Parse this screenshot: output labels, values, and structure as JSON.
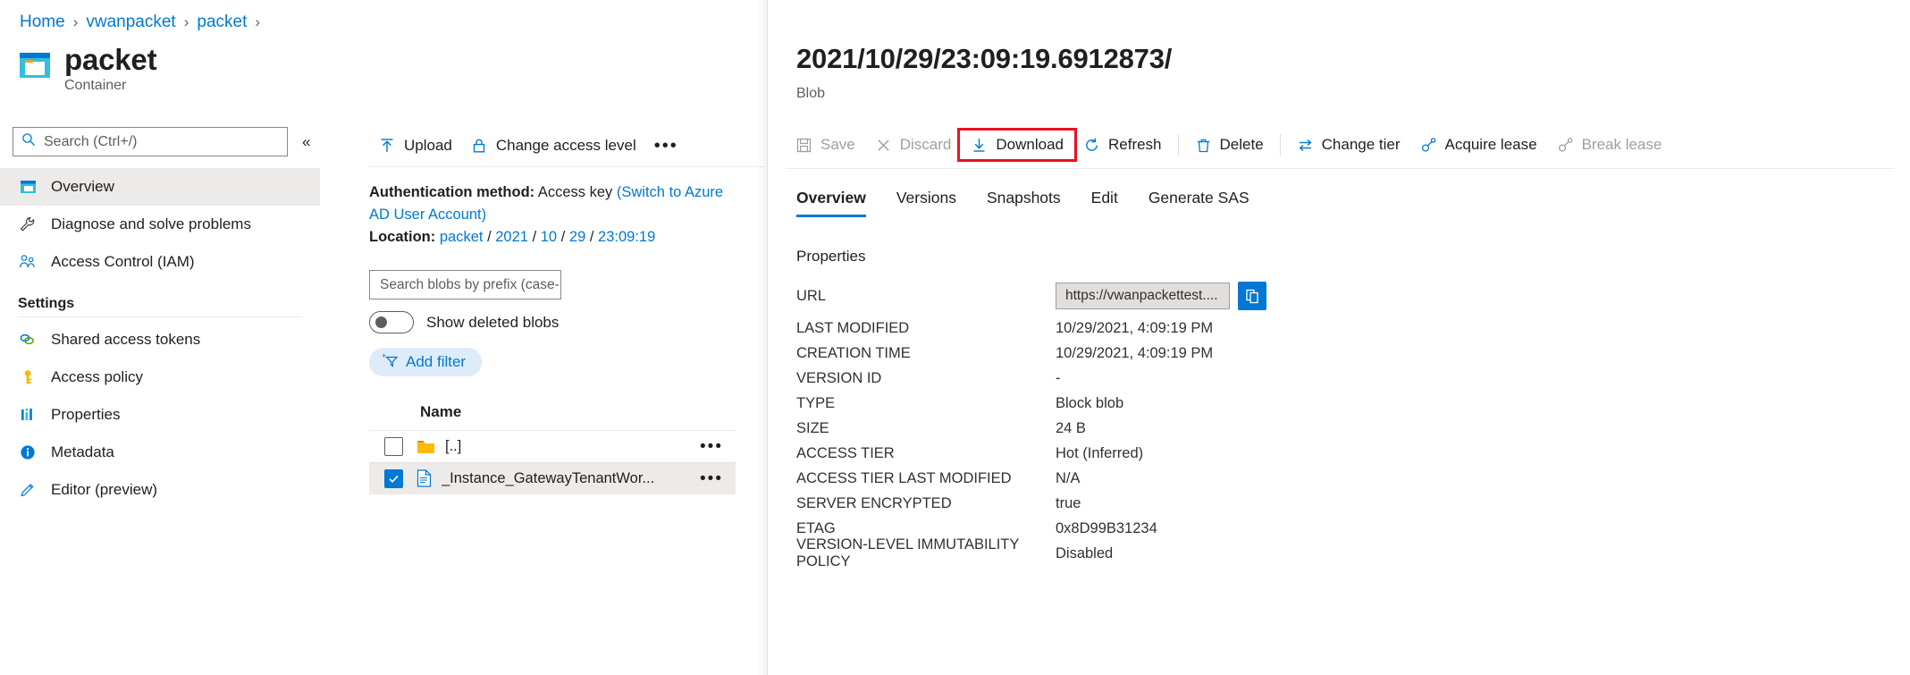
{
  "breadcrumb": {
    "items": [
      {
        "label": "Home",
        "link": true
      },
      {
        "label": "vwanpacket",
        "link": true
      },
      {
        "label": "packet",
        "link": true
      }
    ],
    "separator": "›"
  },
  "resource": {
    "title": "packet",
    "subtitle": "Container",
    "icon": "container-icon"
  },
  "leftnav": {
    "search": {
      "placeholder": "Search (Ctrl+/)",
      "value": "",
      "icon": "search-icon"
    },
    "collapse_icon": "«",
    "items": [
      {
        "label": "Overview",
        "icon": "overview-icon",
        "selected": true
      },
      {
        "label": "Diagnose and solve problems",
        "icon": "wrench-icon",
        "selected": false
      },
      {
        "label": "Access Control (IAM)",
        "icon": "people-icon",
        "selected": false
      }
    ],
    "group_title": "Settings",
    "settings_items": [
      {
        "label": "Shared access tokens",
        "icon": "link-rings-icon"
      },
      {
        "label": "Access policy",
        "icon": "key-icon"
      },
      {
        "label": "Properties",
        "icon": "bars-icon"
      },
      {
        "label": "Metadata",
        "icon": "info-icon"
      },
      {
        "label": "Editor (preview)",
        "icon": "pencil-icon"
      }
    ]
  },
  "midpanel": {
    "toolbar": [
      {
        "label": "Upload",
        "icon": "upload-icon"
      },
      {
        "label": "Change access level",
        "icon": "lock-icon"
      }
    ],
    "overflow_label": "•••",
    "auth": {
      "method_label": "Authentication method:",
      "method_value": "Access key",
      "switch_link": "(Switch to Azure AD User Account)",
      "location_label": "Location:",
      "location_parts": [
        "packet",
        "2021",
        "10",
        "29",
        "23:09:19"
      ],
      "location_sep": "/"
    },
    "blob_search": {
      "placeholder": "Search blobs by prefix (case-...",
      "value": ""
    },
    "show_deleted": {
      "label": "Show deleted blobs",
      "on": false
    },
    "add_filter": {
      "label": "Add filter",
      "icon": "add-filter-icon"
    },
    "filelist": {
      "header": "Name",
      "rows": [
        {
          "name": "[..]",
          "icon": "folder-icon",
          "checked": false,
          "selected": false,
          "menu": "•••"
        },
        {
          "name": "_Instance_GatewayTenantWor...",
          "icon": "file-icon",
          "checked": true,
          "selected": true,
          "menu": "•••"
        }
      ]
    }
  },
  "rightpanel": {
    "title": "2021/10/29/23:09:19.6912873/",
    "subtitle": "Blob",
    "commands": [
      {
        "label": "Save",
        "icon": "save-icon",
        "disabled": true,
        "highlighted": false,
        "sep_after": false
      },
      {
        "label": "Discard",
        "icon": "discard-icon",
        "disabled": true,
        "highlighted": false,
        "sep_after": false
      },
      {
        "label": "Download",
        "icon": "download-icon",
        "disabled": false,
        "highlighted": true,
        "sep_after": false
      },
      {
        "label": "Refresh",
        "icon": "refresh-icon",
        "disabled": false,
        "highlighted": false,
        "sep_after": true
      },
      {
        "label": "Delete",
        "icon": "trash-icon",
        "disabled": false,
        "highlighted": false,
        "sep_after": true
      },
      {
        "label": "Change tier",
        "icon": "change-tier-icon",
        "disabled": false,
        "highlighted": false,
        "sep_after": false
      },
      {
        "label": "Acquire lease",
        "icon": "lease-icon",
        "disabled": false,
        "highlighted": false,
        "sep_after": false
      },
      {
        "label": "Break lease",
        "icon": "lease-icon",
        "disabled": true,
        "highlighted": false,
        "sep_after": false
      }
    ],
    "tabs": [
      {
        "label": "Overview",
        "active": true
      },
      {
        "label": "Versions",
        "active": false
      },
      {
        "label": "Snapshots",
        "active": false
      },
      {
        "label": "Edit",
        "active": false
      },
      {
        "label": "Generate SAS",
        "active": false
      }
    ],
    "properties_heading": "Properties",
    "url": {
      "key": "URL",
      "value": "https://vwanpackettest....",
      "copy_icon": "copy-icon"
    },
    "rows": [
      {
        "key": "LAST MODIFIED",
        "value": "10/29/2021, 4:09:19 PM"
      },
      {
        "key": "CREATION TIME",
        "value": "10/29/2021, 4:09:19 PM"
      },
      {
        "key": "VERSION ID",
        "value": "-"
      },
      {
        "key": "TYPE",
        "value": "Block blob"
      },
      {
        "key": "SIZE",
        "value": "24 B"
      },
      {
        "key": "ACCESS TIER",
        "value": "Hot (Inferred)"
      },
      {
        "key": "ACCESS TIER LAST MODIFIED",
        "value": "N/A"
      },
      {
        "key": "SERVER ENCRYPTED",
        "value": "true"
      },
      {
        "key": "ETAG",
        "value": "0x8D99B31234"
      },
      {
        "key": "VERSION-LEVEL IMMUTABILITY POLICY",
        "value": "Disabled"
      }
    ]
  },
  "colors": {
    "accent": "#0078d4",
    "highlight_box": "#e81123",
    "selected_bg": "#edebe9",
    "folder_yellow": "#ffb900",
    "text": "#201f1e",
    "muted": "#605e5c",
    "disabled": "#a19f9d"
  }
}
